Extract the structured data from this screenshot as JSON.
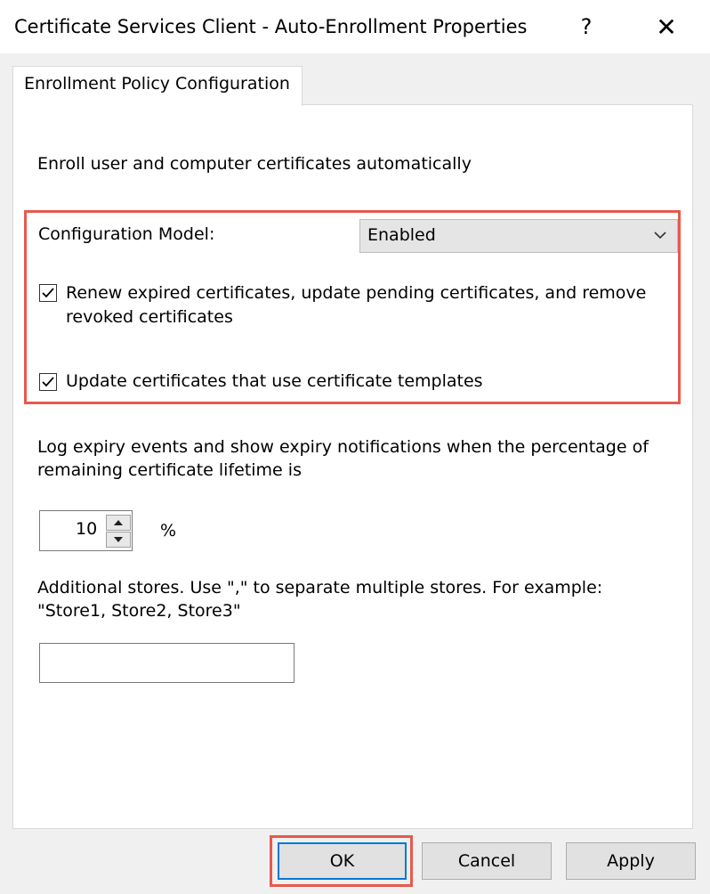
{
  "window": {
    "title": "Certificate Services Client - Auto-Enrollment Properties",
    "help_glyph": "?",
    "close_glyph": "✕"
  },
  "tab": {
    "label": "Enrollment Policy Configuration"
  },
  "panel": {
    "intro": "Enroll user and computer certificates automatically",
    "config_model_label": "Configuration Model:",
    "config_model_value": "Enabled",
    "renew_checkbox": {
      "checked": true,
      "label_line1": "Renew expired certificates, update pending certificates, and remove",
      "label_line2": "revoked certificates"
    },
    "update_checkbox": {
      "checked": true,
      "label": "Update certificates that use certificate templates"
    },
    "expiry_text_line1": "Log expiry events and show expiry notifications when the percentage of",
    "expiry_text_line2": "remaining certificate lifetime is",
    "expiry_value": "10",
    "percent_sign": "%",
    "stores_text_line1": "Additional stores. Use \",\" to separate multiple stores. For example:",
    "stores_text_line2": "\"Store1, Store2, Store3\"",
    "stores_value": ""
  },
  "buttons": {
    "ok": "OK",
    "cancel": "Cancel",
    "apply": "Apply"
  },
  "colors": {
    "highlight": "#e8594c",
    "focus": "#0078d7"
  }
}
